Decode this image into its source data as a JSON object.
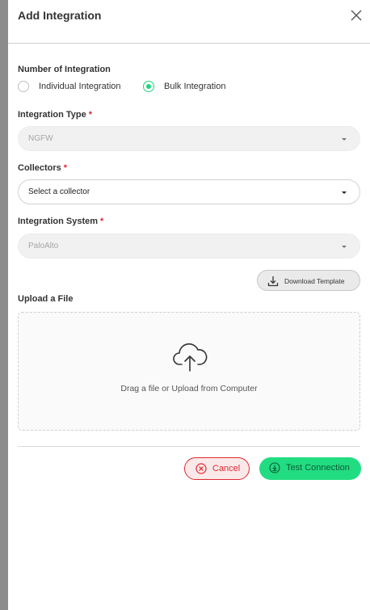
{
  "dialog": {
    "title": "Add Integration"
  },
  "number_of_integration": {
    "label": "Number of Integration",
    "options": [
      {
        "label": "Individual Integration",
        "selected": false
      },
      {
        "label": "Bulk Integration",
        "selected": true
      }
    ]
  },
  "integration_type": {
    "label": "Integration Type",
    "required_mark": "*",
    "value": "NGFW"
  },
  "collectors": {
    "label": "Collectors",
    "required_mark": "*",
    "value": "Select a collector"
  },
  "integration_system": {
    "label": "Integration System",
    "required_mark": "*",
    "value": "PaloAlto"
  },
  "download_template": {
    "label": "Download Template"
  },
  "upload": {
    "label": "Upload a File",
    "dropzone_text": "Drag a file or Upload from Computer"
  },
  "actions": {
    "cancel_label": "Cancel",
    "test_label": "Test Connection"
  },
  "colors": {
    "accent_green": "#22dc82",
    "danger_red": "#e0282e"
  },
  "icons": {
    "close": "close-icon",
    "download": "download-icon",
    "upload": "cloud-upload-icon",
    "cancel": "cancel-circle-icon",
    "test": "download-circle-icon"
  }
}
